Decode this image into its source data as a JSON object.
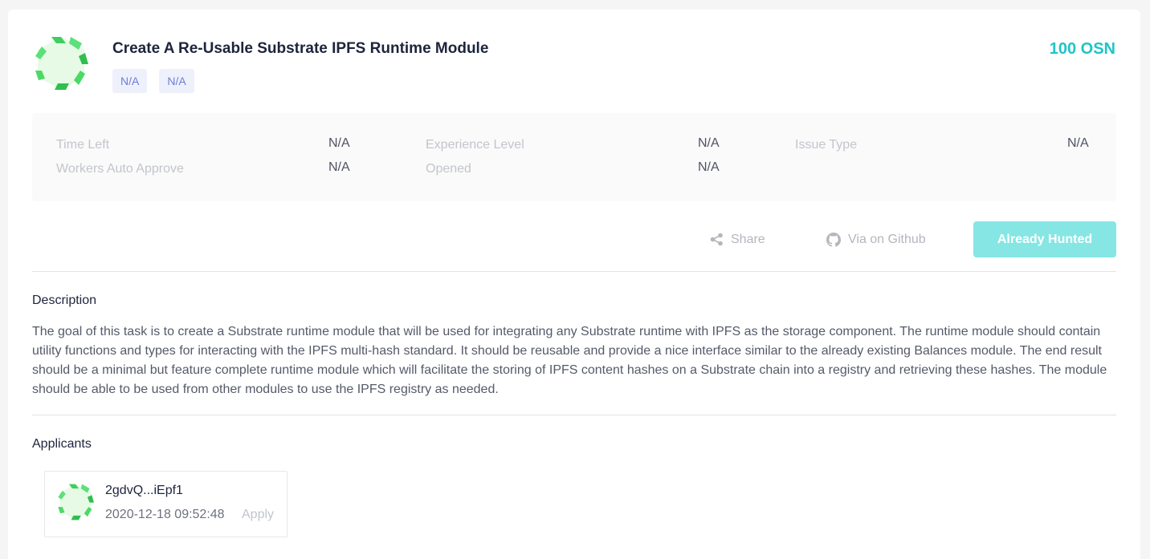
{
  "task": {
    "title": "Create A Re-Usable Substrate IPFS Runtime Module",
    "tags": [
      "N/A",
      "N/A"
    ],
    "reward": "100 OSN",
    "logo_icon": "hexagon-logo-icon"
  },
  "info": {
    "time_left_label": "Time Left",
    "time_left_value": "N/A",
    "experience_label": "Experience Level",
    "experience_value": "N/A",
    "issue_type_label": "Issue Type",
    "issue_type_value": "N/A",
    "workers_label": "Workers Auto Approve",
    "workers_value": "N/A",
    "opened_label": "Opened",
    "opened_value": "N/A"
  },
  "actions": {
    "share_label": "Share",
    "share_icon": "share-icon",
    "github_label": "Via on Github",
    "github_icon": "github-icon",
    "hunt_label": "Already Hunted"
  },
  "description": {
    "heading": "Description",
    "text": "The goal of this task is to create a Substrate runtime module that will be used for integrating any Substrate runtime with IPFS as the storage component. The runtime module should contain utility functions and types for interacting with the IPFS multi-hash standard. It should be reusable and provide a nice interface similar to the already existing Balances module. The end result should be a minimal but feature complete runtime module which will facilitate the storing of IPFS content hashes on a Substrate chain into a registry and retrieving these hashes. The module should be able to be used from other modules to use the IPFS registry as needed."
  },
  "applicants": {
    "heading": "Applicants",
    "items": [
      {
        "name": "2gdvQ...iEpf1",
        "date": "2020-12-18 09:52:48",
        "status": "Apply"
      }
    ]
  },
  "colors": {
    "accent": "#1fc4c7",
    "button_disabled": "#86e6e4",
    "tag_bg": "#eef1fc",
    "tag_text": "#6c7fd6",
    "logo_green": "#4cd964",
    "logo_dark": "#2fbf4f",
    "logo_light": "#e6fae6"
  }
}
